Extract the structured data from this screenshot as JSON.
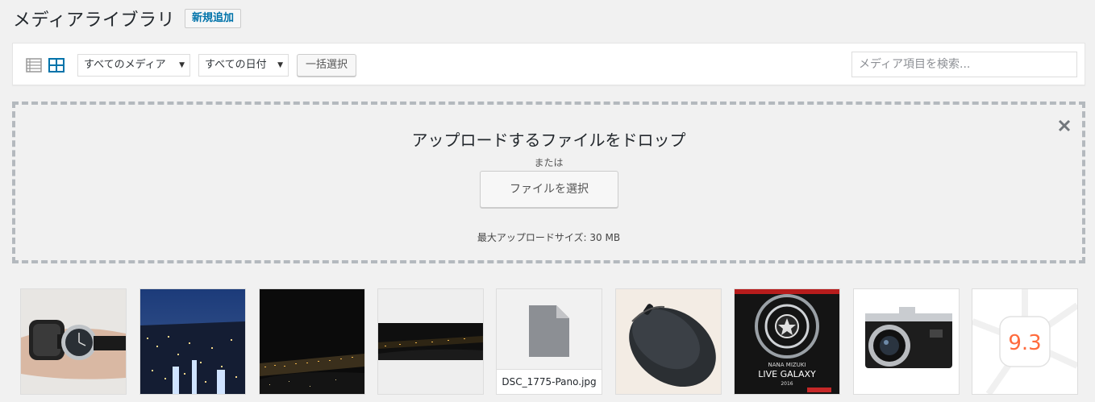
{
  "header": {
    "title": "メディアライブラリ",
    "add_new_label": "新規追加"
  },
  "toolbar": {
    "view_modes": [
      {
        "name": "list",
        "icon": "list-view-icon",
        "active": false
      },
      {
        "name": "grid",
        "icon": "grid-view-icon",
        "active": true
      }
    ],
    "type_filter": {
      "selected": "すべてのメディア"
    },
    "date_filter": {
      "selected": "すべての日付"
    },
    "bulk_select_label": "一括選択",
    "search": {
      "placeholder": "メディア項目を検索...",
      "value": ""
    }
  },
  "uploader": {
    "drop_text": "アップロードするファイルをドロップ",
    "or_text": "または",
    "select_files_label": "ファイルを選択",
    "max_size_text": "最大アップロードサイズ: 30 MB",
    "close_icon": "close-icon"
  },
  "media": {
    "items": [
      {
        "kind": "image",
        "depicts": "smartwatch-on-wrist"
      },
      {
        "kind": "image",
        "depicts": "city-night-view"
      },
      {
        "kind": "image",
        "depicts": "night-coastline"
      },
      {
        "kind": "image",
        "depicts": "panorama-night-view"
      },
      {
        "kind": "file",
        "icon": "document-icon",
        "filename": "DSC_1775-Pano.jpg"
      },
      {
        "kind": "image",
        "depicts": "computer-mouse"
      },
      {
        "kind": "image",
        "depicts": "concert-poster",
        "poster_lines": [
          "NANA MIZUKI",
          "LIVE GALAXY",
          "2016"
        ]
      },
      {
        "kind": "image",
        "depicts": "compact-camera"
      },
      {
        "kind": "image",
        "depicts": "ios-icon",
        "badge_text": "9.3"
      }
    ]
  },
  "colors": {
    "background": "#f1f1f1",
    "accent": "#0073aa",
    "dropzone_border": "#b4b9be",
    "panel": "#ffffff"
  }
}
